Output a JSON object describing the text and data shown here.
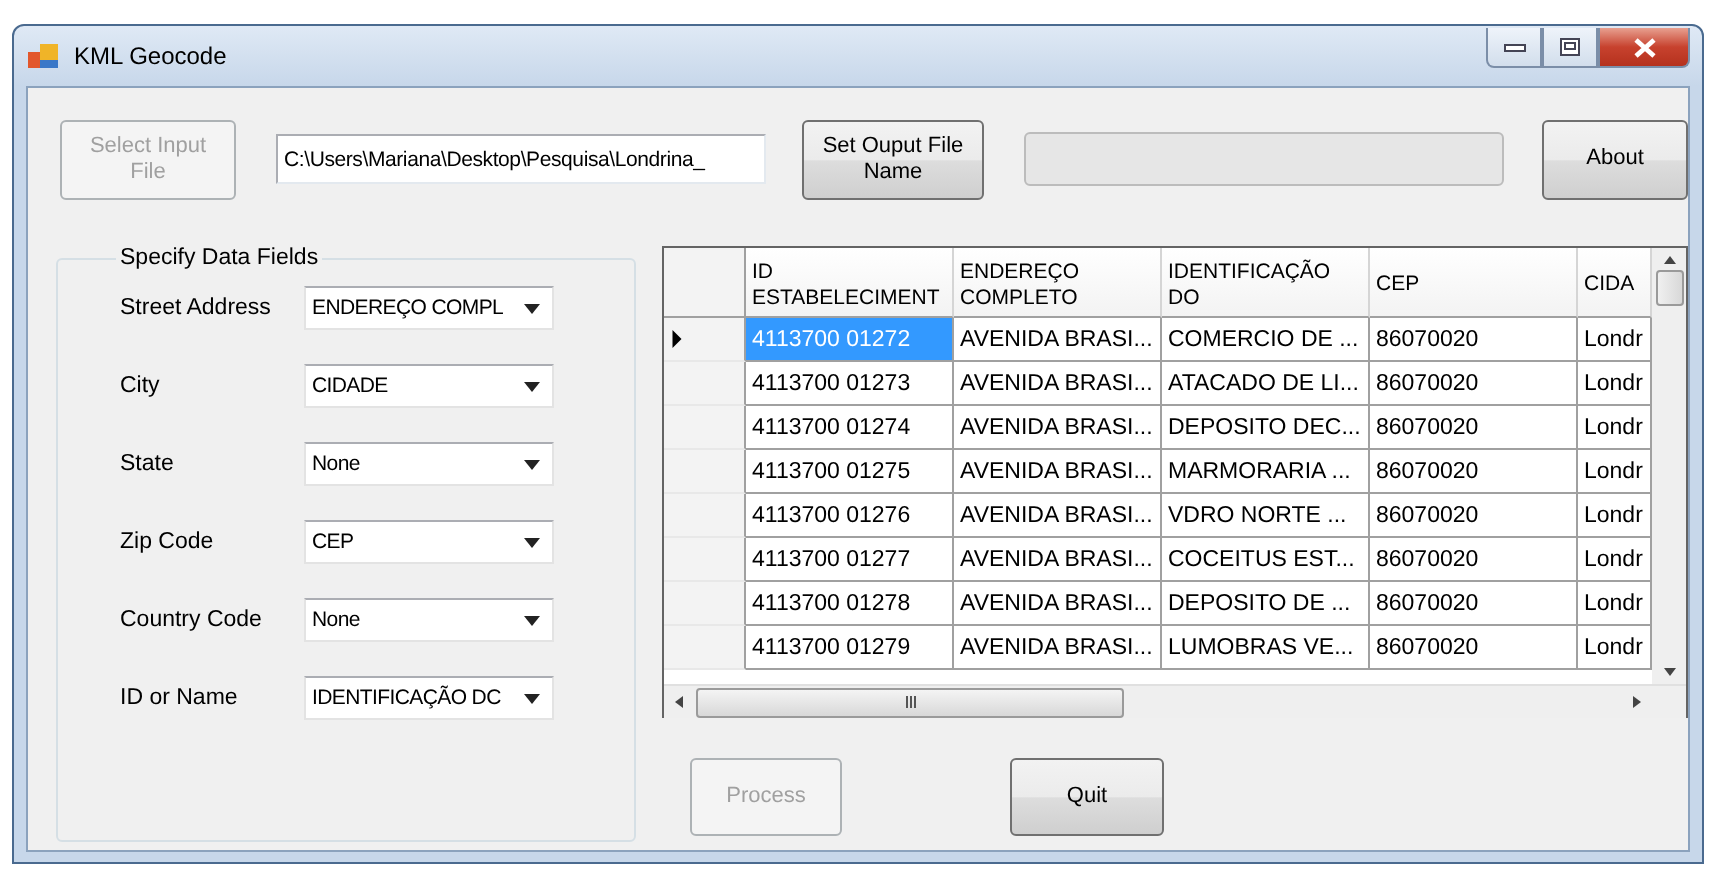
{
  "window": {
    "title": "KML Geocode"
  },
  "input_file": {
    "button": {
      "label": "Select Input File",
      "disabled": true
    },
    "path": "C:\\Users\\Mariana\\Desktop\\Pesquisa\\Londrina_"
  },
  "output_button": {
    "label": "Set Ouput File Name",
    "disabled": false
  },
  "progress": {
    "level": 0
  },
  "about_button": {
    "label": "About",
    "disabled": false
  },
  "data_fields": {
    "title": "Specify Data Fields",
    "fields": [
      {
        "label": "Street Address",
        "value": "ENDEREÇO COMPL"
      },
      {
        "label": "City",
        "value": "CIDADE"
      },
      {
        "label": "State",
        "value": "None"
      },
      {
        "label": "Zip Code",
        "value": "CEP"
      },
      {
        "label": "Country Code",
        "value": "None"
      },
      {
        "label": "ID or Name",
        "value": "IDENTIFICAÇÃO DC"
      }
    ]
  },
  "table": {
    "columns": [
      "ID ESTABELECIMENT",
      "ENDEREÇO COMPLETO",
      "IDENTIFICAÇÃO DO",
      "CEP",
      "CIDA"
    ],
    "rows": [
      {
        "selected": true,
        "cells": [
          "4113700 01272",
          "AVENIDA BRASI...",
          "COMERCIO DE ...",
          "86070020",
          "Londr"
        ]
      },
      {
        "selected": false,
        "cells": [
          "4113700 01273",
          "AVENIDA BRASI...",
          "ATACADO DE LI...",
          "86070020",
          "Londr"
        ]
      },
      {
        "selected": false,
        "cells": [
          "4113700 01274",
          "AVENIDA BRASI...",
          "DEPOSITO DEC...",
          "86070020",
          "Londr"
        ]
      },
      {
        "selected": false,
        "cells": [
          "4113700 01275",
          "AVENIDA BRASI...",
          "MARMORARIA ...",
          "86070020",
          "Londr"
        ]
      },
      {
        "selected": false,
        "cells": [
          "4113700 01276",
          "AVENIDA BRASI...",
          "VDRO NORTE ...",
          "86070020",
          "Londr"
        ]
      },
      {
        "selected": false,
        "cells": [
          "4113700 01277",
          "AVENIDA BRASI...",
          "COCEITUS EST...",
          "86070020",
          "Londr"
        ]
      },
      {
        "selected": false,
        "cells": [
          "4113700 01278",
          "AVENIDA BRASI...",
          "DEPOSITO DE ...",
          "86070020",
          "Londr"
        ]
      },
      {
        "selected": false,
        "cells": [
          "4113700 01279",
          "AVENIDA BRASI...",
          "LUMOBRAS VE...",
          "86070020",
          "Londr"
        ]
      }
    ]
  },
  "process_button": {
    "label": "Process",
    "disabled": true
  },
  "quit_button": {
    "label": "Quit",
    "disabled": false
  }
}
